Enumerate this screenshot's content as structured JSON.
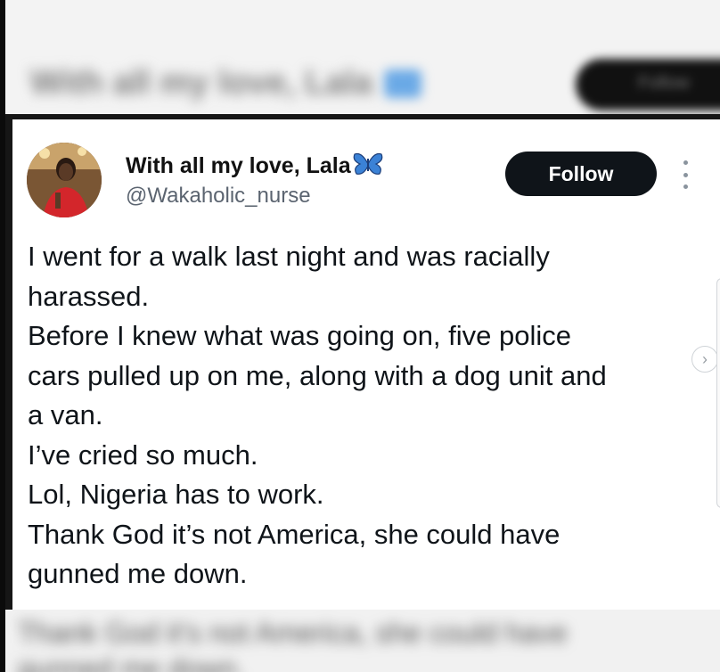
{
  "background_header": {
    "blurred_name": "With all my love, Lala",
    "blurred_button": "Follow"
  },
  "tweet": {
    "display_name": "With all my love, Lala",
    "handle": "@Wakaholic_nurse",
    "follow_label": "Follow",
    "lines": [
      "I went for a walk last night and was racially",
      "harassed.",
      "Before I knew what was going on, five police",
      "cars pulled up on me, along with a dog unit and",
      "a van.",
      "I’ve cried so much.",
      "Lol, Nigeria has to work.",
      "Thank God it’s not America, she could have",
      "gunned me down."
    ]
  },
  "background_footer": {
    "blurred_line1": "Thank God it’s not America, she could have",
    "blurred_line2": "gunned me down."
  },
  "icons": {
    "badge": "butterfly-icon",
    "menu": "more-icon",
    "carousel": "chevron-right-icon"
  },
  "colors": {
    "follow_bg": "#0f1419",
    "handle": "#5b6470",
    "badge": "#3b82d6"
  }
}
